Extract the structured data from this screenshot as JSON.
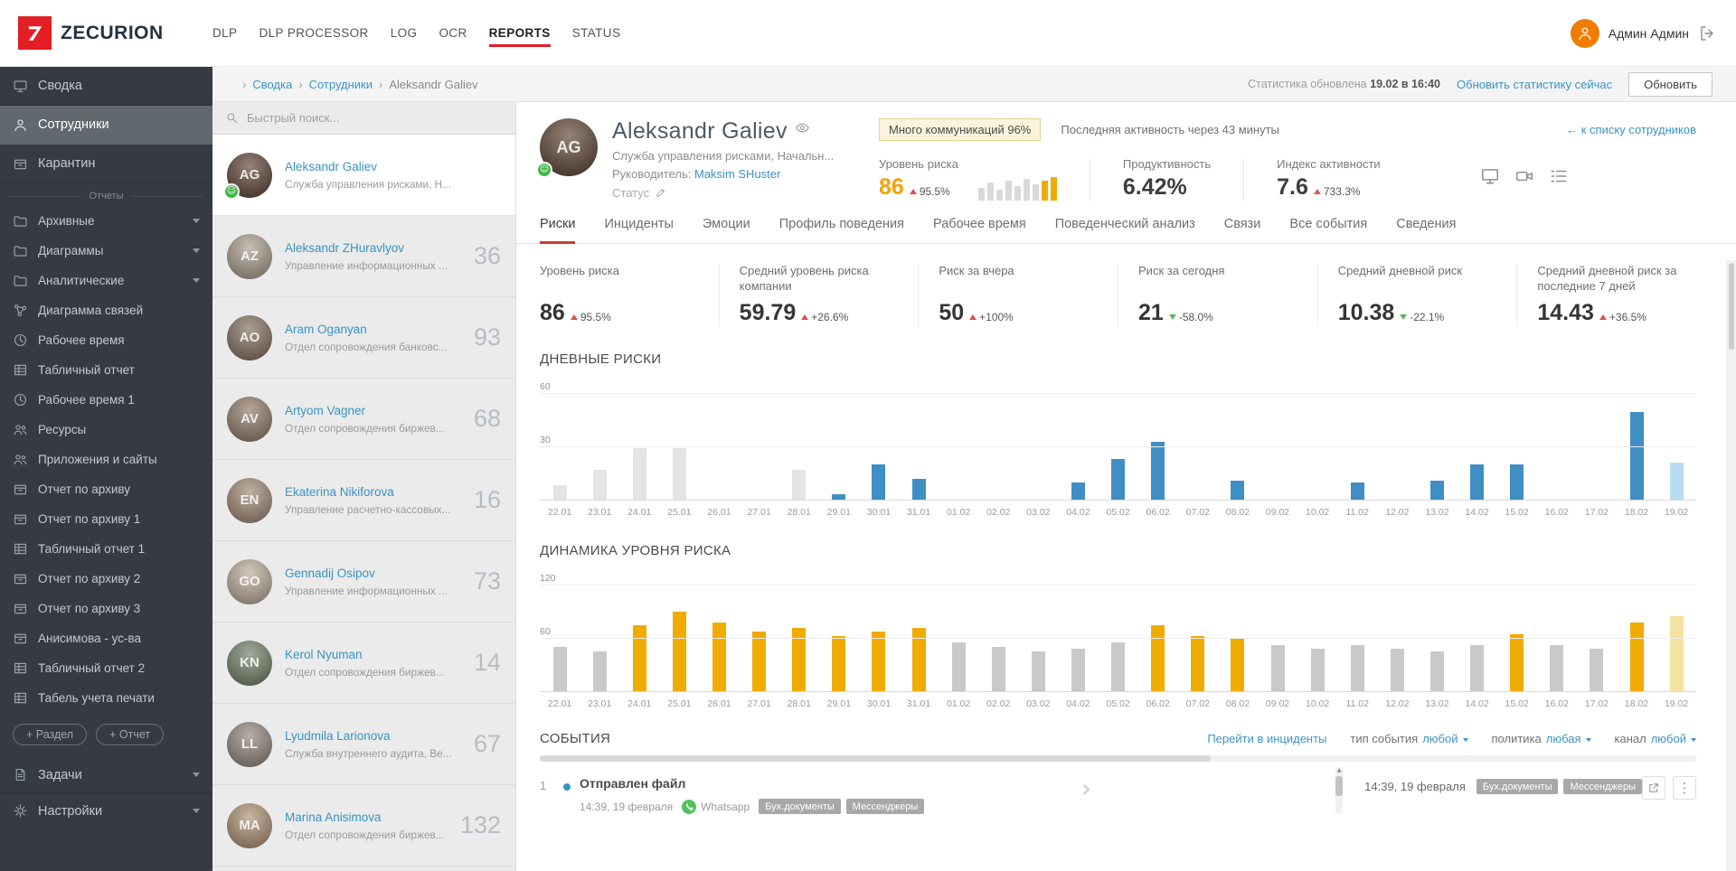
{
  "colors": {
    "accent_red": "#e31e24",
    "link_blue": "#3a93c5",
    "accent_orange": "#f2a200",
    "bar_blue": "#3f8fc4",
    "bar_orange": "#f0ab00",
    "delta_up_red": "#d9534f",
    "delta_down_green": "#5cb85c"
  },
  "topnav": {
    "brand": "ZECURION",
    "items": [
      {
        "label": "DLP",
        "active": false
      },
      {
        "label": "DLP PROCESSOR",
        "active": false
      },
      {
        "label": "LOG",
        "active": false
      },
      {
        "label": "OCR",
        "active": false
      },
      {
        "label": "REPORTS",
        "active": true
      },
      {
        "label": "STATUS",
        "active": false
      }
    ],
    "user_name": "Админ Админ"
  },
  "sidebar": {
    "main_items": [
      {
        "label": "Сводка",
        "icon": "monitor",
        "active": false
      },
      {
        "label": "Сотрудники",
        "icon": "user",
        "active": true
      },
      {
        "label": "Карантин",
        "icon": "box",
        "active": false
      }
    ],
    "section_label": "Отчеты",
    "report_items": [
      {
        "label": "Архивные",
        "icon": "folder",
        "expandable": true
      },
      {
        "label": "Диаграммы",
        "icon": "folder",
        "expandable": true
      },
      {
        "label": "Аналитические",
        "icon": "folder",
        "expandable": true
      },
      {
        "label": "Диаграмма связей",
        "icon": "graph",
        "expandable": false
      },
      {
        "label": "Рабочее время",
        "icon": "clock",
        "expandable": false
      },
      {
        "label": "Табличный отчет",
        "icon": "table",
        "expandable": false
      },
      {
        "label": "Рабочее время 1",
        "icon": "clock",
        "expandable": false
      },
      {
        "label": "Ресурсы",
        "icon": "users",
        "expandable": false
      },
      {
        "label": "Приложения и сайты",
        "icon": "users",
        "expandable": false
      },
      {
        "label": "Отчет по архиву",
        "icon": "box",
        "expandable": false
      },
      {
        "label": "Отчет по архиву 1",
        "icon": "box",
        "expandable": false
      },
      {
        "label": "Табличный отчет 1",
        "icon": "table",
        "expandable": false
      },
      {
        "label": "Отчет по архиву 2",
        "icon": "box",
        "expandable": false
      },
      {
        "label": "Отчет по архиву 3",
        "icon": "box",
        "expandable": false
      },
      {
        "label": "Анисимова - ус-ва",
        "icon": "box",
        "expandable": false
      },
      {
        "label": "Табличный отчет 2",
        "icon": "table",
        "expandable": false
      },
      {
        "label": "Табель учета печати",
        "icon": "table",
        "expandable": false
      }
    ],
    "add_buttons": [
      {
        "label": "+ Раздел"
      },
      {
        "label": "+ Отчет"
      }
    ],
    "bottom_items": [
      {
        "label": "Задачи",
        "icon": "doc",
        "expandable": true
      },
      {
        "label": "Настройки",
        "icon": "gear",
        "expandable": true
      }
    ]
  },
  "breadcrumb_bar": {
    "crumbs": [
      {
        "label": "Сводка",
        "link": true
      },
      {
        "label": "Сотрудники",
        "link": true
      },
      {
        "label": "Aleksandr Galiev",
        "link": false
      }
    ],
    "stats_label": "Статистика обновлена",
    "stats_time": "19.02 в 16:40",
    "refresh_link": "Обновить статистику сейчас",
    "refresh_button": "Обновить"
  },
  "employee_panel": {
    "search_placeholder": "Быстрый поиск...",
    "employees": [
      {
        "name": "Aleksandr Galiev",
        "dept": "Служба управления рисками, Н...",
        "score": "",
        "selected": true,
        "mood": true,
        "avatar_color": "#6b5344"
      },
      {
        "name": "Aleksandr ZHuravlyov",
        "dept": "Управление информационных ...",
        "score": "36",
        "selected": false,
        "mood": false,
        "avatar_color": "#b2a695"
      },
      {
        "name": "Aram Oganyan",
        "dept": "Отдел сопровождения банковс...",
        "score": "93",
        "selected": false,
        "mood": false,
        "avatar_color": "#8d7a6b"
      },
      {
        "name": "Artyom Vagner",
        "dept": "Отдел сопровождения биржев...",
        "score": "68",
        "selected": false,
        "mood": false,
        "avatar_color": "#9a8573"
      },
      {
        "name": "Ekaterina Nikiforova",
        "dept": "Управление расчетно-кассовых...",
        "score": "16",
        "selected": false,
        "mood": false,
        "avatar_color": "#a9927e"
      },
      {
        "name": "Gennadij Osipov",
        "dept": "Управление информационных ...",
        "score": "73",
        "selected": false,
        "mood": false,
        "avatar_color": "#c2b3a0"
      },
      {
        "name": "Kerol Nyuman",
        "dept": "Отдел сопровождения биржев...",
        "score": "14",
        "selected": false,
        "mood": false,
        "avatar_color": "#7d8a70"
      },
      {
        "name": "Lyudmila Larionova",
        "dept": "Служба внутреннего аудита, Ве...",
        "score": "67",
        "selected": false,
        "mood": false,
        "avatar_color": "#9b8f86"
      },
      {
        "name": "Marina Anisimova",
        "dept": "Отдел сопровождения биржев...",
        "score": "132",
        "selected": false,
        "mood": false,
        "avatar_color": "#b59a7e"
      }
    ]
  },
  "profile": {
    "name": "Aleksandr Galiev",
    "position": "Служба управления рисками, Начальн...",
    "supervisor_label": "Руководитель:",
    "supervisor": "Maksim SHuster",
    "status_label": "Статус",
    "badge": "Много коммуникаций 96%",
    "last_activity": "Последняя активность через 43 минуты",
    "back_link": "← к списку сотрудников",
    "metrics": {
      "risk_label": "Уровень риска",
      "risk_value": "86",
      "risk_delta": "95.5%",
      "risk_dir": "up",
      "minibars": [
        14,
        20,
        12,
        22,
        16,
        24,
        18,
        22,
        26
      ],
      "minibars_accent_from": 7,
      "productivity_label": "Продуктивность",
      "productivity_value": "6.42%",
      "activity_label": "Индекс активности",
      "activity_value": "7.6",
      "activity_delta": "733.3%",
      "activity_dir": "up"
    }
  },
  "tabs": [
    {
      "label": "Риски",
      "active": true
    },
    {
      "label": "Инциденты",
      "active": false
    },
    {
      "label": "Эмоции",
      "active": false
    },
    {
      "label": "Профиль поведения",
      "active": false
    },
    {
      "label": "Рабочее время",
      "active": false
    },
    {
      "label": "Поведенческий анализ",
      "active": false
    },
    {
      "label": "Связи",
      "active": false
    },
    {
      "label": "Все события",
      "active": false
    },
    {
      "label": "Сведения",
      "active": false
    }
  ],
  "stat_cards": [
    {
      "label": "Уровень риска",
      "value": "86",
      "delta": "95.5%",
      "dir": "up"
    },
    {
      "label": "Средний уровень риска компании",
      "value": "59.79",
      "delta": "+26.6%",
      "dir": "up"
    },
    {
      "label": "Риск за вчера",
      "value": "50",
      "delta": "+100%",
      "dir": "up"
    },
    {
      "label": "Риск за сегодня",
      "value": "21",
      "delta": "-58.0%",
      "dir": "down"
    },
    {
      "label": "Средний дневной риск",
      "value": "10.38",
      "delta": "-22.1%",
      "dir": "down"
    },
    {
      "label": "Средний дневной риск за последние 7 дней",
      "value": "14.43",
      "delta": "+36.5%",
      "dir": "up"
    }
  ],
  "chart_data": [
    {
      "type": "bar",
      "title": "ДНЕВНЫЕ РИСКИ",
      "ylim": [
        0,
        60
      ],
      "yticks": [
        30,
        60
      ],
      "grid": true,
      "legend": "none",
      "categories": [
        "22.01",
        "23.01",
        "24.01",
        "25.01",
        "26.01",
        "27.01",
        "28.01",
        "29.01",
        "30.01",
        "31.01",
        "01.02",
        "02.02",
        "03.02",
        "04.02",
        "05.02",
        "06.02",
        "07.02",
        "08.02",
        "09.02",
        "10.02",
        "11.02",
        "12.02",
        "13.02",
        "14.02",
        "15.02",
        "16.02",
        "17.02",
        "18.02",
        "19.02"
      ],
      "values": [
        8,
        17,
        29,
        29,
        0,
        0,
        17,
        3,
        20,
        12,
        0,
        0,
        0,
        10,
        23,
        33,
        0,
        11,
        0,
        0,
        10,
        0,
        11,
        20,
        20,
        0,
        0,
        50,
        21
      ],
      "bar_colors": [
        "gray",
        "gray",
        "gray",
        "gray",
        "gray",
        "gray",
        "gray",
        "accent",
        "accent",
        "accent",
        "accent",
        "accent",
        "accent",
        "accent",
        "accent",
        "accent",
        "accent",
        "accent",
        "accent",
        "accent",
        "accent",
        "accent",
        "accent",
        "accent",
        "accent",
        "accent",
        "accent",
        "accent",
        "today"
      ],
      "palette": {
        "gray": "#e4e4e4",
        "accent": "#3f8fc4",
        "today": "#b9dcf0"
      }
    },
    {
      "type": "bar",
      "title": "ДИНАМИКА УРОВНЯ РИСКА",
      "ylim": [
        0,
        120
      ],
      "yticks": [
        60,
        120
      ],
      "grid": true,
      "legend": "none",
      "categories": [
        "22.01",
        "23.01",
        "24.01",
        "25.01",
        "26.01",
        "27.01",
        "28.01",
        "29.01",
        "30.01",
        "31.01",
        "01.02",
        "02.02",
        "03.02",
        "04.02",
        "05.02",
        "06.02",
        "07.02",
        "08.02",
        "09.02",
        "10.02",
        "11.02",
        "12.02",
        "13.02",
        "14.02",
        "15.02",
        "16.02",
        "17.02",
        "18.02",
        "19.02"
      ],
      "values": [
        50,
        45,
        75,
        90,
        78,
        68,
        72,
        63,
        68,
        72,
        55,
        50,
        45,
        48,
        55,
        75,
        63,
        60,
        52,
        48,
        52,
        48,
        45,
        52,
        65,
        52,
        48,
        78,
        85
      ],
      "bar_colors": [
        "gray",
        "gray",
        "accent",
        "accent",
        "accent",
        "accent",
        "accent",
        "accent",
        "accent",
        "accent",
        "gray",
        "gray",
        "gray",
        "gray",
        "gray",
        "accent",
        "accent",
        "accent",
        "gray",
        "gray",
        "gray",
        "gray",
        "gray",
        "gray",
        "accent",
        "gray",
        "gray",
        "accent",
        "today"
      ],
      "palette": {
        "gray": "#c9c9c9",
        "accent": "#f0ab00",
        "today": "#f6e2a0"
      }
    }
  ],
  "events": {
    "title": "СОБЫТИЯ",
    "incidents_link": "Перейти в инциденты",
    "filters": [
      {
        "label": "тип события",
        "value": "любой"
      },
      {
        "label": "политика",
        "value": "любая"
      },
      {
        "label": "канал",
        "value": "любой"
      }
    ],
    "items": [
      {
        "num": "1",
        "title": "Отправлен файл",
        "time": "14:39, 19 февраля",
        "channel": "Whatsapp",
        "tags": [
          "Бух.документы",
          "Мессенджеры"
        ],
        "meta_time": "14:39, 19 февраля",
        "meta_tags": [
          "Бух.документы",
          "Мессенджеры"
        ]
      }
    ]
  }
}
